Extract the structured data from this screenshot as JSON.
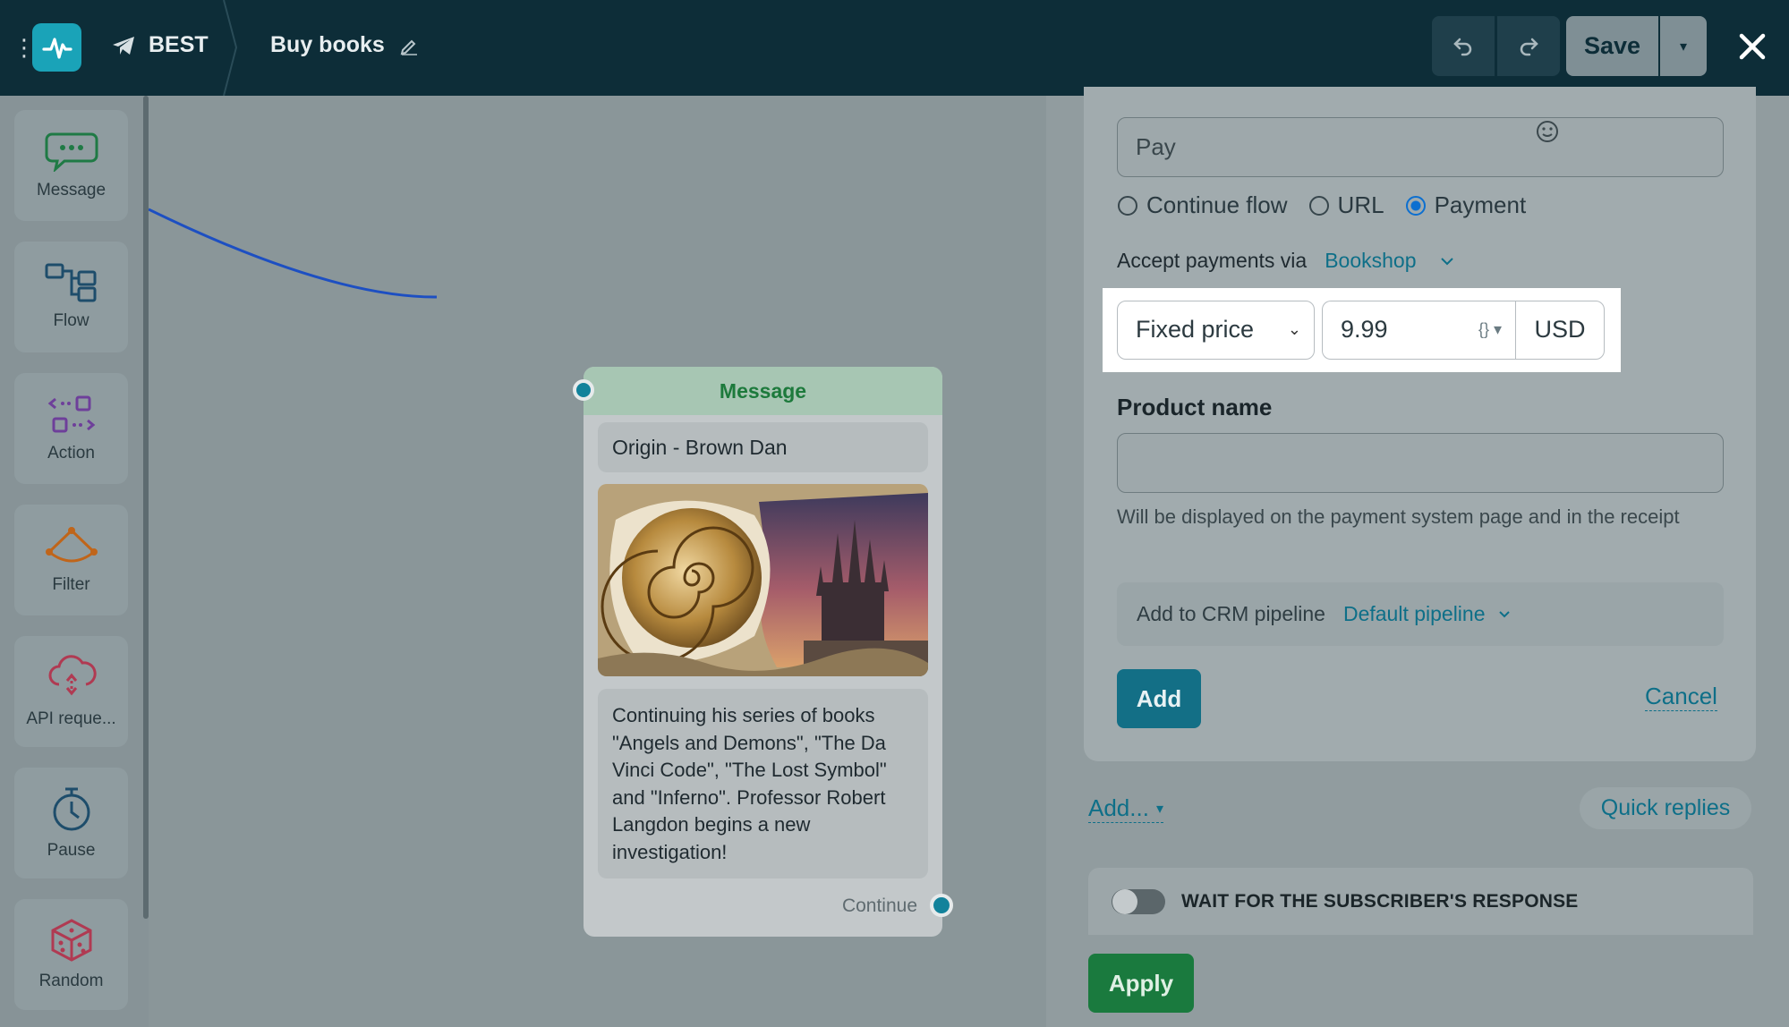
{
  "header": {
    "channel": "BEST",
    "flow_title": "Buy books",
    "save_label": "Save"
  },
  "palette": [
    {
      "label": "Message",
      "icon": "message-bubble-icon"
    },
    {
      "label": "Flow",
      "icon": "flow-icon"
    },
    {
      "label": "Action",
      "icon": "action-icon"
    },
    {
      "label": "Filter",
      "icon": "filter-icon"
    },
    {
      "label": "API reque...",
      "icon": "api-request-icon"
    },
    {
      "label": "Pause",
      "icon": "clock-icon"
    },
    {
      "label": "Random",
      "icon": "dice-icon"
    }
  ],
  "node": {
    "header": "Message",
    "title": "Origin - Brown Dan",
    "text": "Continuing his series of books \"Angels and Demons\", \"The Da Vinci Code\", \"The Lost Symbol\" and \"Inferno\". Professor Robert Langdon begins a new investigation!",
    "continue_label": "Continue"
  },
  "panel": {
    "button_text": "Pay",
    "radio_options": [
      {
        "label": "Continue flow",
        "selected": false
      },
      {
        "label": "URL",
        "selected": false
      },
      {
        "label": "Payment",
        "selected": true
      }
    ],
    "accept_label": "Accept payments via",
    "accept_provider": "Bookshop",
    "price_type": "Fixed price",
    "price_value": "9.99",
    "currency": "USD",
    "product_label": "Product name",
    "product_value": "",
    "product_help": "Will be displayed on the payment system page and in the receipt",
    "crm_label": "Add to CRM pipeline",
    "crm_value": "Default pipeline",
    "add_label": "Add",
    "cancel_label": "Cancel",
    "add_more_label": "Add...",
    "quick_replies_label": "Quick replies",
    "wait_label": "WAIT FOR THE SUBSCRIBER'S RESPONSE",
    "wait_enabled": false,
    "apply_label": "Apply"
  },
  "colors": {
    "header_bg": "#0d2d38",
    "accent": "#136f86",
    "link": "#0e6f88",
    "apply": "#1a7a3e",
    "message_head": "#1d7a3c"
  }
}
